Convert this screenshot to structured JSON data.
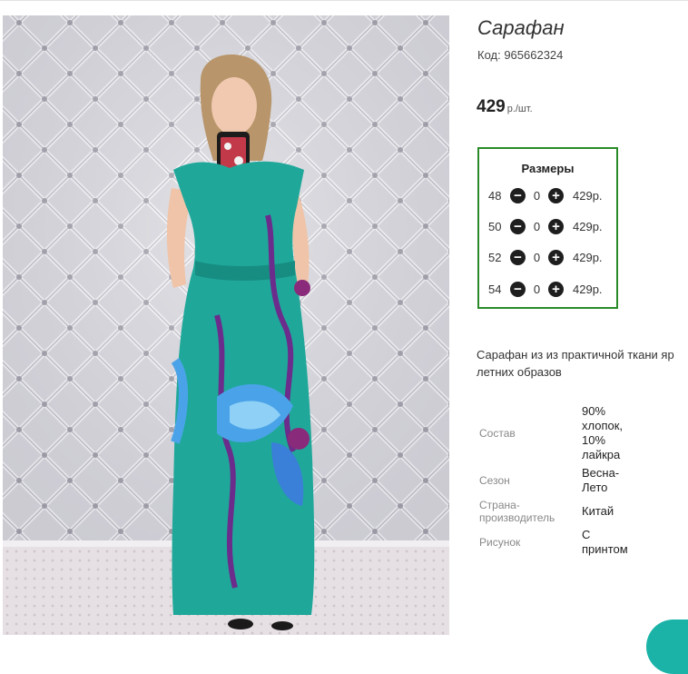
{
  "product": {
    "title": "Сарафан",
    "code": "Код: 965662324",
    "price": "429",
    "price_unit": "р./шт."
  },
  "sizes": {
    "heading": "Размеры",
    "rows": [
      {
        "size": "48",
        "qty": "0",
        "price": "429р."
      },
      {
        "size": "50",
        "qty": "0",
        "price": "429р."
      },
      {
        "size": "52",
        "qty": "0",
        "price": "429р."
      },
      {
        "size": "54",
        "qty": "0",
        "price": "429р."
      }
    ],
    "minus_icon": "minus-circle-icon",
    "plus_icon": "plus-circle-icon"
  },
  "description": {
    "line1": "Сарафан из из практичной ткани яр",
    "line2": "летних образов"
  },
  "specs": [
    {
      "label": "Состав",
      "value": "90% хлопок, 10% лайкра"
    },
    {
      "label": "Сезон",
      "value": "Весна-Лето"
    },
    {
      "label": "Страна-производитель",
      "value": "Китай"
    },
    {
      "label": "Рисунок",
      "value": "С принтом"
    }
  ],
  "colors": {
    "size_box_border": "#2a8a2a",
    "dress": "#1fa89a",
    "chat_accent": "#1bb3a7"
  }
}
